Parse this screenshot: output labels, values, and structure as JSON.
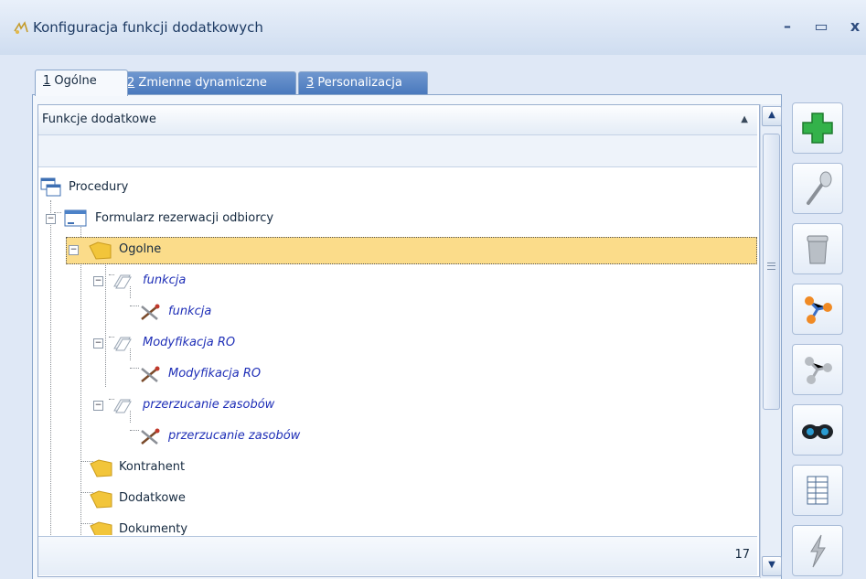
{
  "window": {
    "title": "Konfiguracja funkcji dodatkowych",
    "minimize": "–",
    "maximize": "▭",
    "close": "x"
  },
  "tabs": [
    {
      "key": "1",
      "label": "Ogólne"
    },
    {
      "key": "2",
      "label": "Zmienne dynamiczne"
    },
    {
      "key": "3",
      "label": "Personalizacja"
    }
  ],
  "grid": {
    "column_header": "Funkcje dodatkowe",
    "sort_indicator": "▲",
    "filter_value": "",
    "count": "17"
  },
  "tree": [
    {
      "label": "Procedury"
    },
    {
      "label": "Formularz rezerwacji odbiorcy"
    },
    {
      "label": "Ogolne"
    },
    {
      "label": "funkcja"
    },
    {
      "label": "funkcja"
    },
    {
      "label": "Modyfikacja RO"
    },
    {
      "label": "Modyfikacja RO"
    },
    {
      "label": "przerzucanie zasobów"
    },
    {
      "label": "przerzucanie zasobów"
    },
    {
      "label": "Kontrahent"
    },
    {
      "label": "Dodatkowe"
    },
    {
      "label": "Dokumenty"
    }
  ],
  "toolbar": {
    "icons": [
      "add-icon",
      "edit-icon",
      "delete-icon",
      "link-icon",
      "unlink-icon",
      "binoculars-icon",
      "table-icon",
      "lightning-icon"
    ]
  },
  "colors": {
    "selection": "#fbdc8a",
    "italic_text": "#1f2fb7",
    "tab_inactive": "#4a79bd"
  }
}
